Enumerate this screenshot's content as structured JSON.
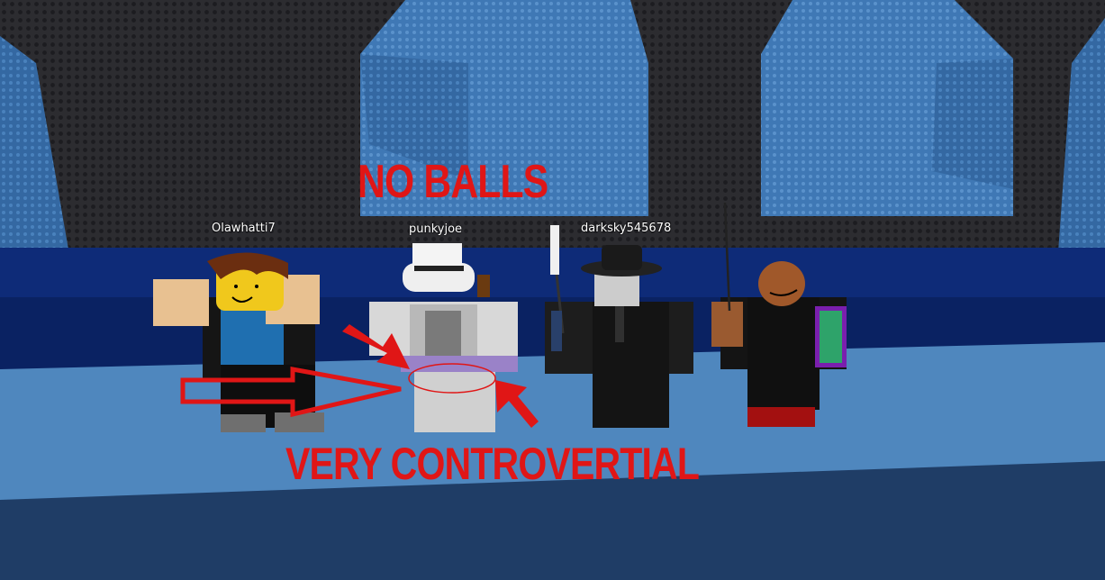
{
  "scene": {
    "players": [
      {
        "name": "Olawhatti7"
      },
      {
        "name": "punkyjoe"
      },
      {
        "name": "darksky545678"
      }
    ],
    "captions": {
      "top": "NO BALLS",
      "bottom": "VERY CONTROVERTIAL"
    },
    "colors": {
      "annotation_red": "#e01616",
      "wall": "#2c2c30",
      "stage": "#4f87be",
      "floor": "#1f3d66"
    }
  }
}
